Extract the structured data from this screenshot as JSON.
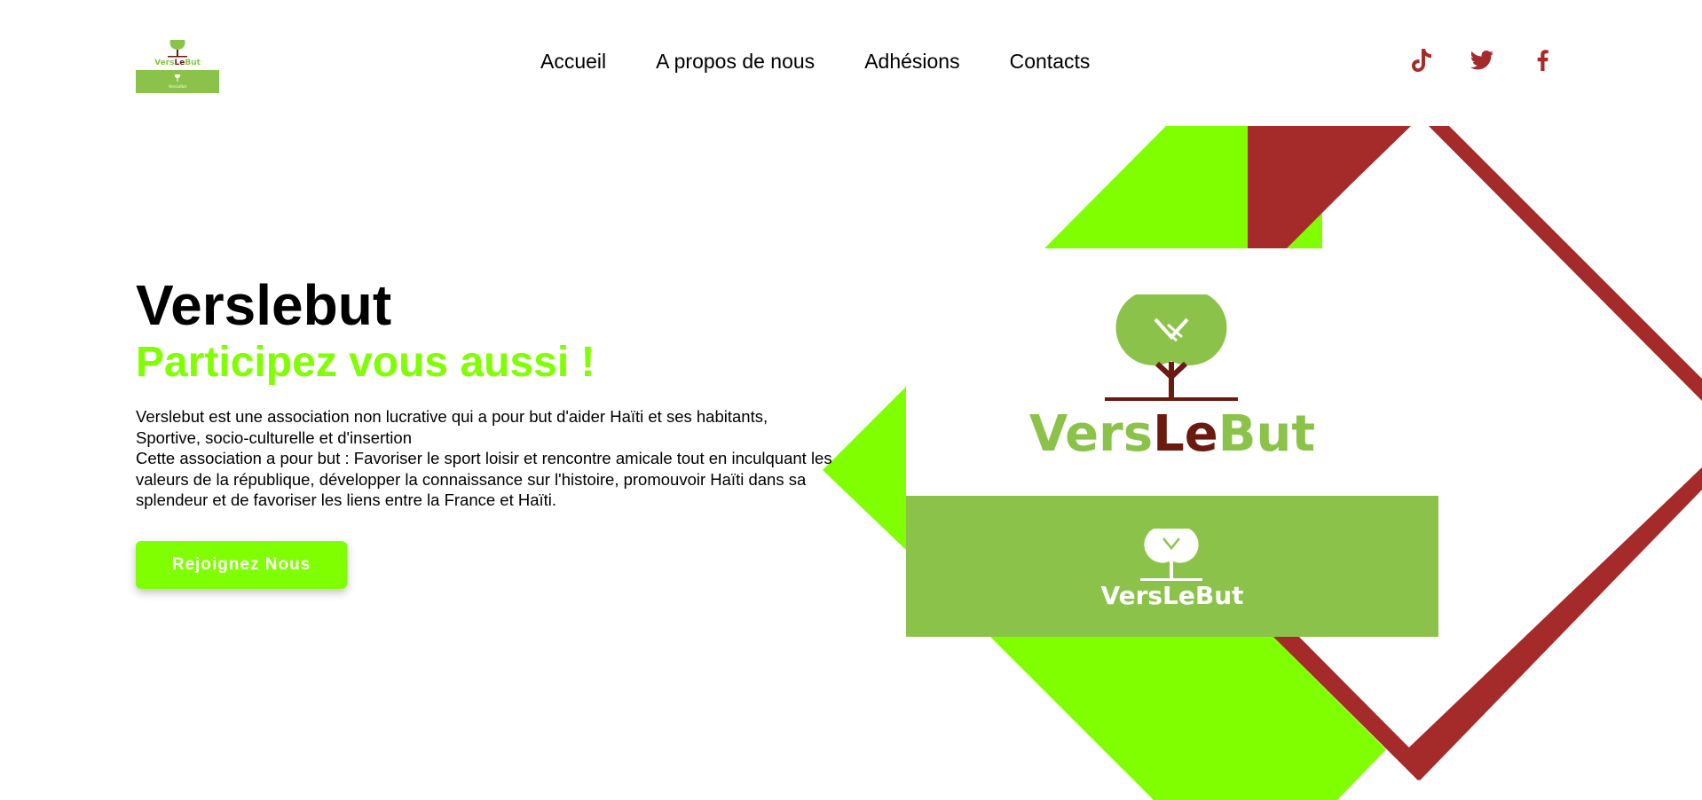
{
  "colors": {
    "brand_green": "#80ff00",
    "logo_green": "#8bc34a",
    "logo_brown": "#6b1a10",
    "accent_red": "#a52a2a",
    "social_red": "#a52a2a",
    "text": "#000000",
    "button_text": "#ffffff"
  },
  "header": {
    "logo": {
      "brand_vers": "Vers",
      "brand_le": "Le",
      "brand_but": "But",
      "small_caption": "VersLeBut"
    },
    "nav": [
      {
        "label": "Accueil"
      },
      {
        "label": "A propos de nous"
      },
      {
        "label": "Adhésions"
      },
      {
        "label": "Contacts"
      }
    ],
    "social": [
      {
        "icon": "tiktok-icon"
      },
      {
        "icon": "twitter-icon"
      },
      {
        "icon": "facebook-icon"
      }
    ]
  },
  "hero": {
    "title": "Verslebut",
    "subtitle": "Participez vous aussi !",
    "description": [
      "Verslebut est une association non lucrative qui a pour but d'aider Haïti et ses habitants, Sportive, socio-culturelle et d'insertion",
      "Cette association a pour but : Favoriser le sport loisir et rencontre amicale tout en inculquant les valeurs de la république, développer la connaissance sur l'histoire, promouvoir Haïti dans sa splendeur et de favoriser les liens entre la France et Haïti."
    ],
    "cta_label": "Rejoignez Nous"
  },
  "graphic": {
    "logo_large": {
      "vers": "Vers",
      "le": "Le",
      "but": "But"
    },
    "logo_banner": {
      "text": "VersLeBut"
    }
  }
}
